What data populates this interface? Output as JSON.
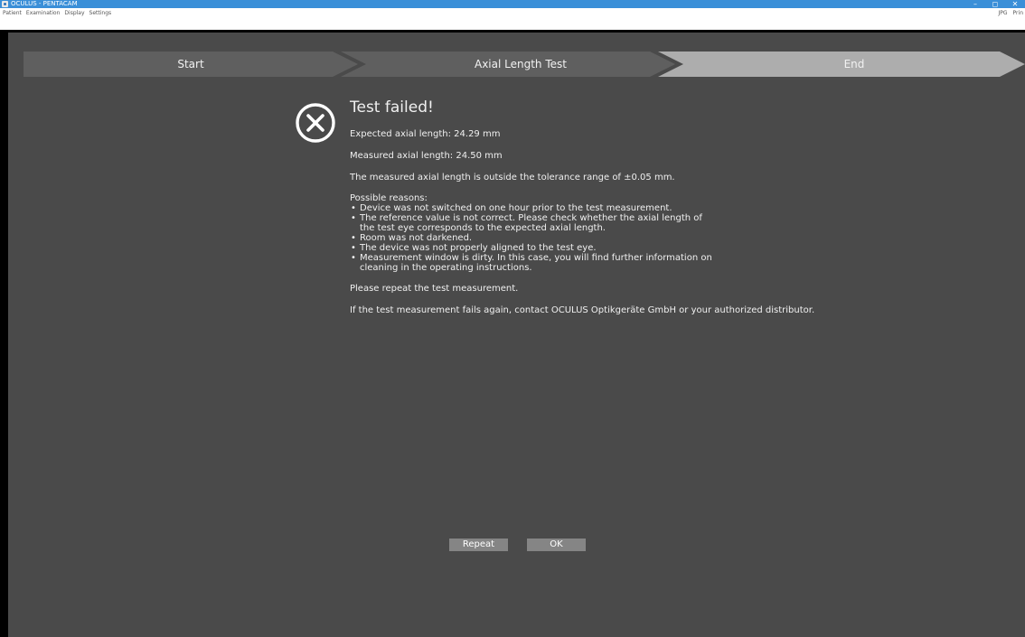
{
  "window": {
    "title": "OCULUS - PENTACAM",
    "controls": [
      "–",
      "◻",
      "✕"
    ]
  },
  "menu": {
    "items": [
      "Patient",
      "Examination",
      "Display",
      "Settings"
    ],
    "right_items": [
      "JPG",
      "Prin"
    ]
  },
  "steps": [
    {
      "label": "Start",
      "state": "done"
    },
    {
      "label": "Axial Length Test",
      "state": "done"
    },
    {
      "label": "End",
      "state": "current"
    }
  ],
  "colors": {
    "step_done": "#5f5f5f",
    "step_current": "#adadad",
    "background": "#4a4a4a",
    "button": "#858585"
  },
  "icon": "error-circle-x-icon",
  "result": {
    "heading": "Test failed!",
    "expected": "Expected axial length: 24.29 mm",
    "measured": "Measured axial length: 24.50 mm",
    "tolerance": "The measured axial length is outside the tolerance range of ±0.05 mm.",
    "reasons_title": "Possible reasons:",
    "reasons": [
      "Device was not switched on one hour prior to the test measurement.",
      "The reference value is not correct. Please check whether the axial length of\nthe test eye corresponds to the expected axial length.",
      "Room was not darkened.",
      "The device was not properly aligned to the test eye.",
      "Measurement window is dirty. In this case, you will find further information on\ncleaning in the operating instructions."
    ],
    "repeat_note": "Please repeat the test measurement.",
    "contact_note": "If the test measurement fails again, contact OCULUS Optikgeräte GmbH or your authorized distributor."
  },
  "buttons": {
    "repeat": "Repeat",
    "ok": "OK"
  }
}
